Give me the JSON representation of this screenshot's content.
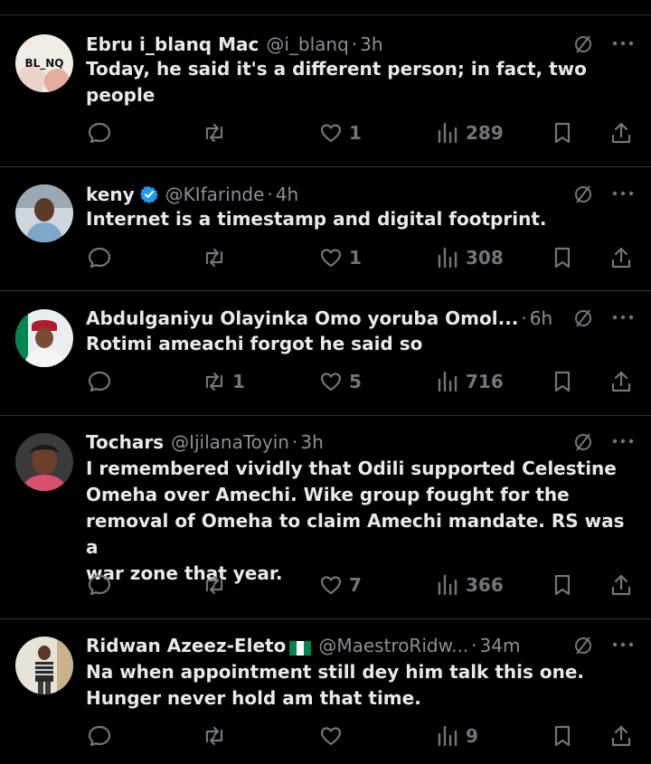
{
  "posts": [
    {
      "name": "Ebru i_blanq Mac",
      "handle": "@i_blanq",
      "time": "3h",
      "text": [
        "Today, he said it's a different person; in fact, two",
        "people"
      ],
      "replies": "",
      "reposts": "",
      "likes": "1",
      "views": "289",
      "avatar_text": "BL_NQ",
      "verified": false,
      "flag": false
    },
    {
      "name": "keny",
      "handle": "@KIfarinde",
      "time": "4h",
      "text": [
        "Internet is a timestamp and digital footprint."
      ],
      "replies": "",
      "reposts": "",
      "likes": "1",
      "views": "308",
      "verified": true,
      "flag": false
    },
    {
      "name": "Abdulganiyu Olayinka Omo yoruba Omol...",
      "handle": "",
      "time": "6h",
      "text": [
        "Rotimi ameachi forgot he said so"
      ],
      "replies": "",
      "reposts": "1",
      "likes": "5",
      "views": "716",
      "verified": false,
      "flag": false
    },
    {
      "name": "Tochars",
      "handle": "@IjilanaToyin",
      "time": "3h",
      "text": [
        "I remembered vividly that Odili supported Celestine",
        "Omeha over Amechi. Wike group fought for the",
        "removal of Omeha to claim Amechi mandate. RS was a",
        "war zone that year."
      ],
      "replies": "",
      "reposts": "",
      "likes": "7",
      "views": "366",
      "verified": false,
      "flag": false
    },
    {
      "name": "Ridwan Azeez-Eleto",
      "handle": "@MaestroRidw...",
      "time": "34m",
      "text": [
        "Na when appointment still dey him talk this one.",
        "Hunger never hold am that time."
      ],
      "replies": "",
      "reposts": "",
      "likes": "",
      "views": "9",
      "verified": false,
      "flag": true
    }
  ],
  "icons": {
    "reply": "speech-bubble-icon",
    "repost": "repost-arrows-icon",
    "like": "heart-icon",
    "views": "bar-chart-icon",
    "bookmark": "bookmark-icon",
    "share": "share-upload-icon",
    "grok": "grok-slash-icon",
    "more": "more-dots-icon"
  },
  "colors": {
    "background": "#000000",
    "text": "#e7e9ea",
    "muted": "#71767b",
    "divider": "#2f3336",
    "verified": "#1d9bf0",
    "flag_green": "#008751"
  }
}
